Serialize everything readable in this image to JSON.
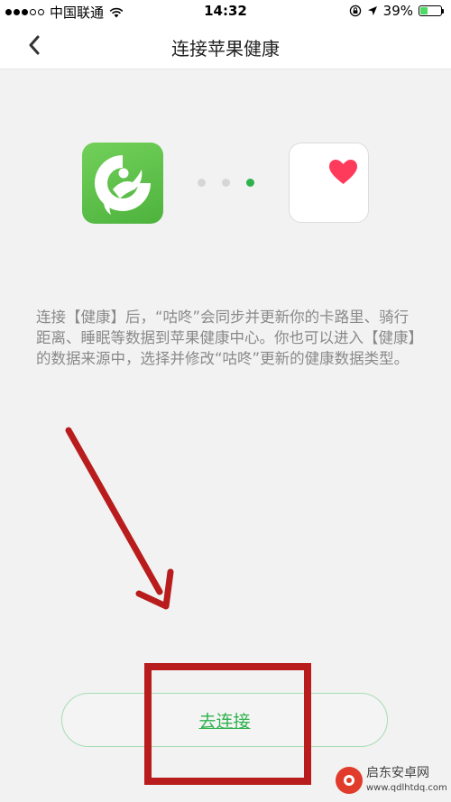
{
  "status_bar": {
    "carrier": "中国联通",
    "time": "14:32",
    "battery_percent": "39%",
    "battery_level": 0.39
  },
  "nav": {
    "title": "连接苹果健康",
    "back_icon": "chevron-left-icon"
  },
  "icons": {
    "app_icon": "codoon-app-icon",
    "health_icon": "apple-health-heart-icon",
    "accent_green": "#2fb24e",
    "heart_color": "#ff3b5c"
  },
  "pager": {
    "count": 3,
    "active_index": 2
  },
  "description": "连接【健康】后，“咕咚”会同步并更新你的卡路里、骑行距离、睡眠等数据到苹果健康中心。你也可以进入【健康】的数据来源中，选择并修改“咕咚”更新的健康数据类型。",
  "connect_button": {
    "label": "去连接"
  },
  "annotation": {
    "color": "#b81c1c"
  },
  "watermark": {
    "text": "启东安卓网",
    "url": "www.qdlhtdq.com"
  }
}
